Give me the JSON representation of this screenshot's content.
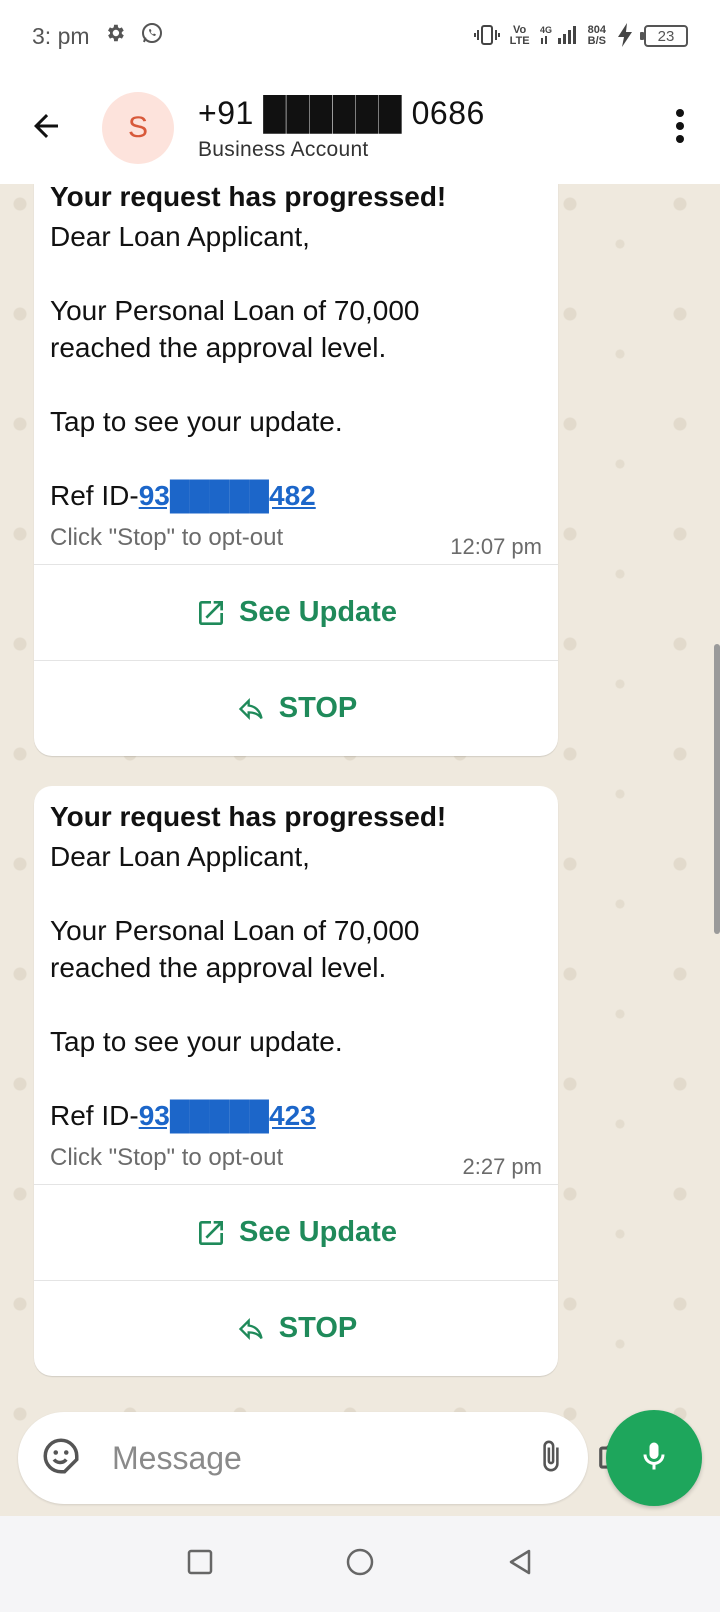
{
  "status_bar": {
    "time": "3:  pm",
    "net_type_top": "Vo",
    "net_type_bottom": "LTE",
    "speed_top": "804",
    "speed_bottom": "B/S",
    "battery": "23"
  },
  "header": {
    "avatar_letter": "S",
    "contact_name": "+91 ██████ 0686",
    "contact_subtitle": "Business Account"
  },
  "messages": [
    {
      "title": "Your request has progressed!",
      "greeting": "Dear Loan Applicant,",
      "body": "Your Personal Loan of 70,000\nreached the approval level.",
      "tap": "Tap to see your update.",
      "ref_prefix": "Ref ID-",
      "ref_id": "93█████482",
      "optout": "Click \"Stop\" to opt-out",
      "time": "12:07 pm",
      "action_primary": "See Update",
      "action_secondary": "STOP"
    },
    {
      "title": "Your request has progressed!",
      "greeting": "Dear Loan Applicant,",
      "body": "Your Personal Loan of 70,000\nreached the approval level.",
      "tap": "Tap to see your update.",
      "ref_prefix": "Ref ID-",
      "ref_id": "93█████423",
      "optout": "Click \"Stop\" to opt-out",
      "time": "2:27 pm",
      "action_primary": "See Update",
      "action_secondary": "STOP"
    }
  ],
  "composer": {
    "placeholder": "Message"
  },
  "colors": {
    "accent_green": "#1f8a5a",
    "mic_green": "#1ea65c",
    "link_blue": "#1c66c9",
    "avatar_bg": "#fde3dc",
    "avatar_fg": "#d8593a",
    "chat_bg": "#efe9de"
  },
  "icons": {
    "back": "arrow-left-icon",
    "menu": "more-vert-icon",
    "see_update": "open-external-icon",
    "stop": "reply-arrow-icon",
    "emoji": "sticker-icon",
    "attach": "paperclip-icon",
    "camera": "camera-icon",
    "mic": "microphone-icon"
  }
}
